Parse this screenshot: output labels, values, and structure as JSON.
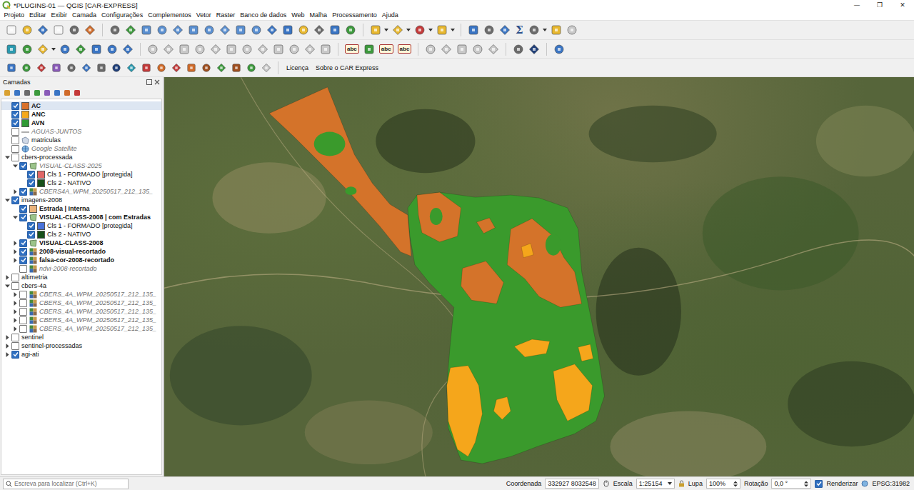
{
  "window": {
    "title": "*PLUGINS-01 — QGIS [CAR-EXPRESS]",
    "controls": [
      "—",
      "❐",
      "✕"
    ]
  },
  "menu": [
    "Projeto",
    "Editar",
    "Exibir",
    "Camada",
    "Configurações",
    "Complementos",
    "Vetor",
    "Raster",
    "Banco de dados",
    "Web",
    "Malha",
    "Processamento",
    "Ajuda"
  ],
  "toolbars": [
    {
      "texts": [
        {
          "label": "Σ",
          "kind": "glyph"
        }
      ]
    },
    {
      "texts": [
        {
          "label": "abc",
          "kind": "badge"
        },
        {
          "label": "abc",
          "kind": "badge"
        },
        {
          "label": "abc",
          "kind": "badge"
        }
      ]
    },
    {
      "texts": [
        {
          "label": "Licença",
          "kind": "link"
        },
        {
          "label": "Sobre o CAR Express",
          "kind": "link"
        }
      ]
    }
  ],
  "layers_panel": {
    "title": "Camadas",
    "layers": [
      {
        "name": "AC",
        "kind": "polygon",
        "depth": 0,
        "checked": true,
        "style": "bold",
        "selected": true,
        "color": "#d9722b"
      },
      {
        "name": "ANC",
        "kind": "polygon",
        "depth": 0,
        "checked": true,
        "style": "bold",
        "selected": false,
        "color": "#f5a81c"
      },
      {
        "name": "AVN",
        "kind": "polygon",
        "depth": 0,
        "checked": true,
        "style": "bold",
        "selected": false,
        "color": "#2f9a34"
      },
      {
        "name": "AGUAS-JUNTOS",
        "kind": "line",
        "depth": 0,
        "checked": false,
        "style": "italic",
        "selected": false
      },
      {
        "name": "matriculas",
        "kind": "vector",
        "depth": 0,
        "checked": false,
        "style": "normal",
        "selected": false
      },
      {
        "name": "Google Satellite",
        "kind": "web",
        "depth": 0,
        "checked": false,
        "style": "italic",
        "selected": false
      },
      {
        "name": "cbers-processada",
        "kind": "group",
        "depth": 0,
        "checked": false,
        "expanded": true,
        "style": "normal",
        "selected": false
      },
      {
        "name": "VISUAL-CLASS-2025",
        "kind": "classified",
        "depth": 1,
        "checked": true,
        "expanded": true,
        "style": "italic",
        "selected": false
      },
      {
        "name": "Cls 1 - FORMADO [protegida]",
        "kind": "category",
        "depth": 2,
        "checked": true,
        "style": "normal",
        "selected": false,
        "color": "#e06666"
      },
      {
        "name": "Cls 2 - NATIVO",
        "kind": "category",
        "depth": 2,
        "checked": true,
        "style": "normal",
        "selected": false,
        "color": "#17501a"
      },
      {
        "name": "CBERS4A_WPM_20250517_212_135_",
        "kind": "raster",
        "depth": 1,
        "checked": true,
        "expanded": false,
        "style": "italic",
        "selected": false
      },
      {
        "name": "imagens-2008",
        "kind": "group",
        "depth": 0,
        "checked": true,
        "expanded": true,
        "style": "normal",
        "selected": false
      },
      {
        "name": "Estrada | Interna",
        "kind": "polygon",
        "depth": 1,
        "checked": true,
        "style": "bold",
        "selected": false,
        "color": "#eab27a"
      },
      {
        "name": "VISUAL-CLASS-2008 | com Estradas",
        "kind": "classified",
        "depth": 1,
        "checked": true,
        "expanded": true,
        "style": "bold",
        "selected": false
      },
      {
        "name": "Cls 1 - FORMADO [protegida]",
        "kind": "category",
        "depth": 2,
        "checked": true,
        "style": "normal",
        "selected": false,
        "color": "#4a72d9"
      },
      {
        "name": "Cls 2 - NATIVO",
        "kind": "category",
        "depth": 2,
        "checked": true,
        "style": "normal",
        "selected": false,
        "color": "#17501a"
      },
      {
        "name": "VISUAL-CLASS-2008",
        "kind": "classified",
        "depth": 1,
        "checked": true,
        "expanded": false,
        "style": "bold",
        "selected": false
      },
      {
        "name": "2008-visual-recortado",
        "kind": "raster",
        "depth": 1,
        "checked": true,
        "expanded": false,
        "style": "bold",
        "selected": false
      },
      {
        "name": "falsa-cor-2008-recortado",
        "kind": "raster",
        "depth": 1,
        "checked": true,
        "expanded": false,
        "style": "bold",
        "selected": false
      },
      {
        "name": "ndvi-2008-recortado",
        "kind": "raster",
        "depth": 1,
        "checked": false,
        "style": "italic",
        "selected": false
      },
      {
        "name": "altimetria",
        "kind": "group",
        "depth": 0,
        "checked": false,
        "expanded": false,
        "style": "normal",
        "selected": false
      },
      {
        "name": "cbers-4a",
        "kind": "group",
        "depth": 0,
        "checked": false,
        "expanded": true,
        "style": "normal",
        "selected": false
      },
      {
        "name": "CBERS_4A_WPM_20250517_212_135_",
        "kind": "raster",
        "depth": 1,
        "checked": false,
        "expanded": false,
        "style": "italic",
        "selected": false
      },
      {
        "name": "CBERS_4A_WPM_20250517_212_135_",
        "kind": "raster",
        "depth": 1,
        "checked": false,
        "expanded": false,
        "style": "italic",
        "selected": false
      },
      {
        "name": "CBERS_4A_WPM_20250517_212_135_",
        "kind": "raster",
        "depth": 1,
        "checked": false,
        "expanded": false,
        "style": "italic",
        "selected": false
      },
      {
        "name": "CBERS_4A_WPM_20250517_212_135_",
        "kind": "raster",
        "depth": 1,
        "checked": false,
        "expanded": false,
        "style": "italic",
        "selected": false
      },
      {
        "name": "CBERS_4A_WPM_20250517_212_135_",
        "kind": "raster",
        "depth": 1,
        "checked": false,
        "expanded": false,
        "style": "italic",
        "selected": false
      },
      {
        "name": "sentinel",
        "kind": "group",
        "depth": 0,
        "checked": false,
        "expanded": false,
        "style": "normal",
        "selected": false
      },
      {
        "name": "sentinel-processadas",
        "kind": "group",
        "depth": 0,
        "checked": false,
        "expanded": false,
        "style": "normal",
        "selected": false
      },
      {
        "name": "agi-ati",
        "kind": "group",
        "depth": 0,
        "checked": true,
        "expanded": false,
        "style": "normal",
        "selected": false
      }
    ]
  },
  "map": {
    "overlays": [
      {
        "color": "#3a9a2c"
      },
      {
        "color": "#d4732a"
      },
      {
        "color": "#f5a61b"
      }
    ]
  },
  "status_bar": {
    "search_placeholder": "Escreva para localizar (Ctrl+K)",
    "coordinate_label": "Coordenada",
    "coordinate": "332927 8032548",
    "scale_label": "Escala",
    "scale": "1:25154",
    "magnifier_label": "Lupa",
    "magnifier": "100%",
    "rotation_label": "Rotação",
    "rotation": "0,0 °",
    "render_label": "Renderizar",
    "render_checked": true,
    "crs": "EPSG:31982"
  }
}
